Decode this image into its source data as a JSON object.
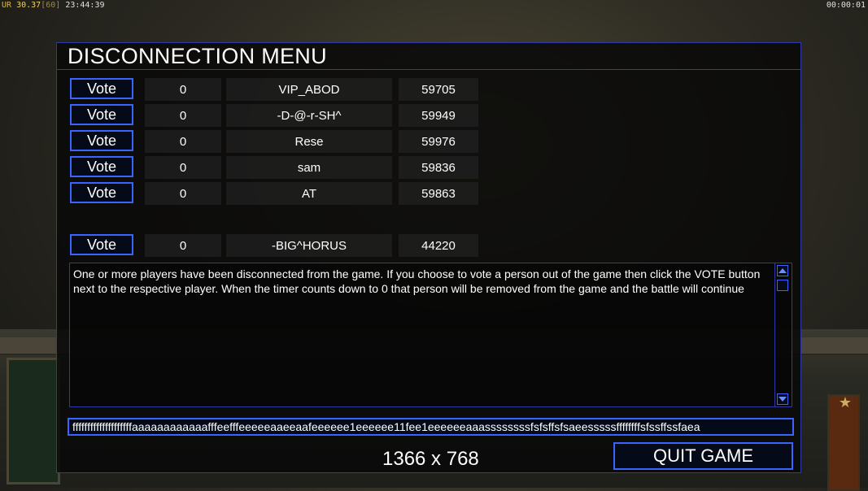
{
  "hud": {
    "ur_label": "UR",
    "fps": "30",
    "fps_secondary": "37",
    "fps_cap": "[60]",
    "clock": "23:44:39",
    "timer": "00:00:01"
  },
  "dialog": {
    "title": "DISCONNECTION MENU",
    "players": [
      {
        "vote_label": "Vote",
        "count": "0",
        "name": "VIP_ABOD",
        "ping": "59705"
      },
      {
        "vote_label": "Vote",
        "count": "0",
        "name": "-D-@-r-SH^",
        "ping": "59949"
      },
      {
        "vote_label": "Vote",
        "count": "0",
        "name": "Rese",
        "ping": "59976"
      },
      {
        "vote_label": "Vote",
        "count": "0",
        "name": "sam",
        "ping": "59836"
      },
      {
        "vote_label": "Vote",
        "count": "0",
        "name": "AT",
        "ping": "59863"
      }
    ],
    "packet_router": {
      "vote_label": "Vote",
      "count": "0",
      "name": "-BIG^HORUS",
      "ping": "44220"
    },
    "message": "One or more players have been disconnected from the game. If you choose to vote a person out of the game then click the VOTE button next to the respective player. When the timer counts down to 0 that person will be removed from the game and the battle will continue",
    "chat_value": "ffffffffffffffffffffaaaaaaaaaaaafffeefffeeeeeaaeeaafeeeeee1eeeeee11fee1eeeeeeaaassssssssfsfsffsfsaeesssssffffffffsfssffssfaea",
    "quit_label": "QUIT GAME"
  },
  "overlay": {
    "resolution": "1366 x 768"
  },
  "colors": {
    "accent_border": "#3a64ff",
    "panel_border": "#2f3aa8",
    "fps_text": "#e8c64a"
  }
}
